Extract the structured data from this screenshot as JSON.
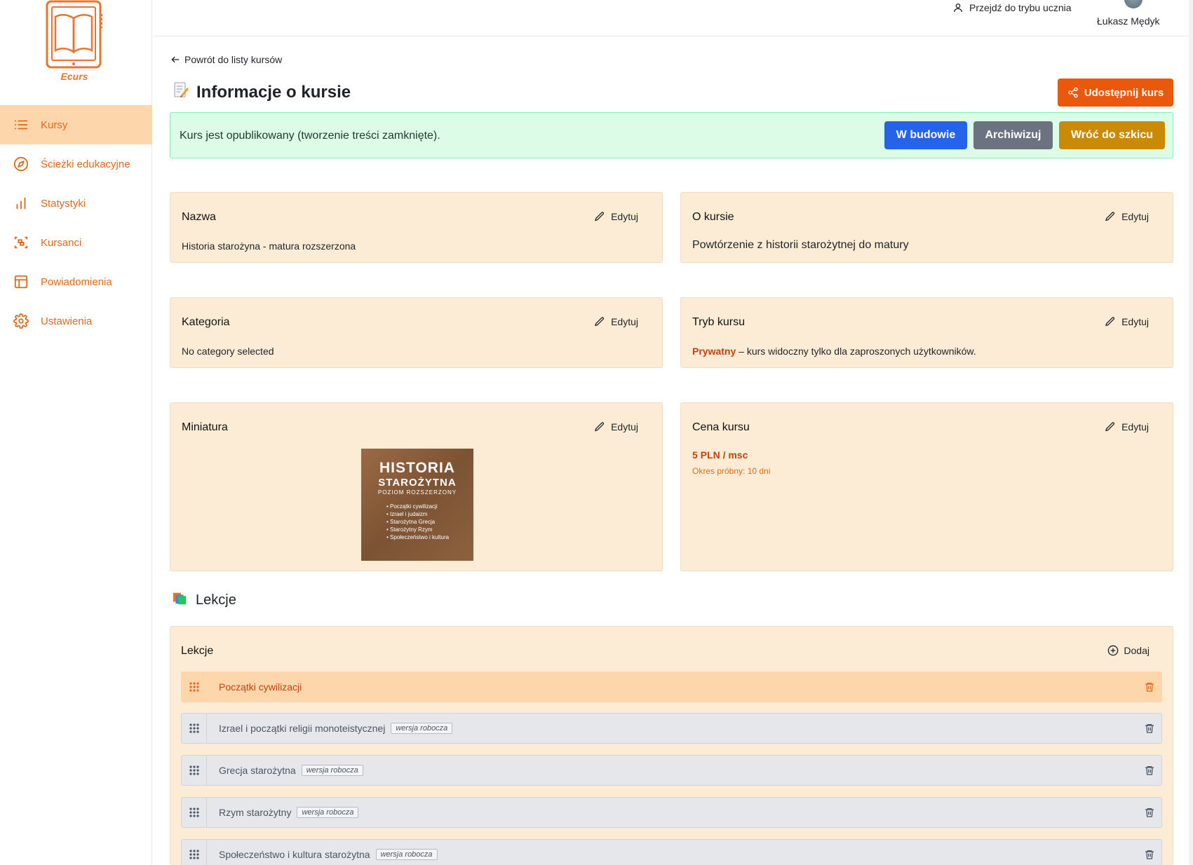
{
  "app": {
    "brand": "Ecurs"
  },
  "sidebar": {
    "items": [
      {
        "label": "Kursy",
        "icon": "list-icon",
        "active": true
      },
      {
        "label": "Ścieżki edukacyjne",
        "icon": "compass-icon"
      },
      {
        "label": "Statystyki",
        "icon": "bar-chart-icon"
      },
      {
        "label": "Kursanci",
        "icon": "users-scan-icon"
      },
      {
        "label": "Powiadomienia",
        "icon": "layout-icon"
      },
      {
        "label": "Ustawienia",
        "icon": "gear-icon"
      }
    ]
  },
  "header": {
    "student_mode": "Przejdź do trybu ucznia",
    "user_name": "Łukasz Mędyk"
  },
  "main": {
    "back_link": "Powrót do listy kursów",
    "title": "Informacje o kursie",
    "share_button": "Udostępnij kurs",
    "status": {
      "text": "Kurs jest opublikowany (tworzenie treści zamknięte).",
      "buttons": [
        "W budowie",
        "Archiwizuj",
        "Wróć do szkicu"
      ]
    },
    "edit_label": "Edytuj",
    "cards": {
      "name": {
        "title": "Nazwa",
        "value": "Historia starożyna - matura rozszerzona"
      },
      "about": {
        "title": "O kursie",
        "value": "Powtórzenie z historii starożytnej do matury"
      },
      "category": {
        "title": "Kategoria",
        "value": "No category selected"
      },
      "mode": {
        "title": "Tryb kursu",
        "accent": "Prywatny",
        "value": " – kurs widoczny tylko dla zaproszonych użytkowników."
      },
      "thumbnail": {
        "title": "Miniatura",
        "image_text": {
          "line1": "HISTORIA",
          "line2": "STAROŻYTNA",
          "line3": "POZIOM ROZSZERZONY",
          "bullets": [
            "• Początki cywilizacji",
            "• Izrael i judaizm",
            "• Starożytna Grecja",
            "• Starożytny Rzym",
            "• Społeczeństwo i kultura"
          ]
        }
      },
      "price": {
        "title": "Cena kursu",
        "value": "5 PLN / msc",
        "trial": "Okres próbny: 10 dni"
      }
    },
    "lessons_section": "Lekcje",
    "lessons": {
      "title": "Lekcje",
      "add_label": "Dodaj",
      "draft_label": "wersja robocza",
      "items": [
        {
          "name": "Początki cywilizacji",
          "draft": false
        },
        {
          "name": "Izrael i początki religii monoteistycznej",
          "draft": true
        },
        {
          "name": "Grecja starożytna",
          "draft": true
        },
        {
          "name": "Rzym starożytny",
          "draft": true
        },
        {
          "name": "Społeczeństwo i kultura starożytna",
          "draft": true
        }
      ]
    }
  },
  "colors": {
    "accent": "#ea580c",
    "sidebar_active": "#fdd6ab",
    "card_bg": "#fdecd5",
    "status_bg": "#dcfce7"
  }
}
